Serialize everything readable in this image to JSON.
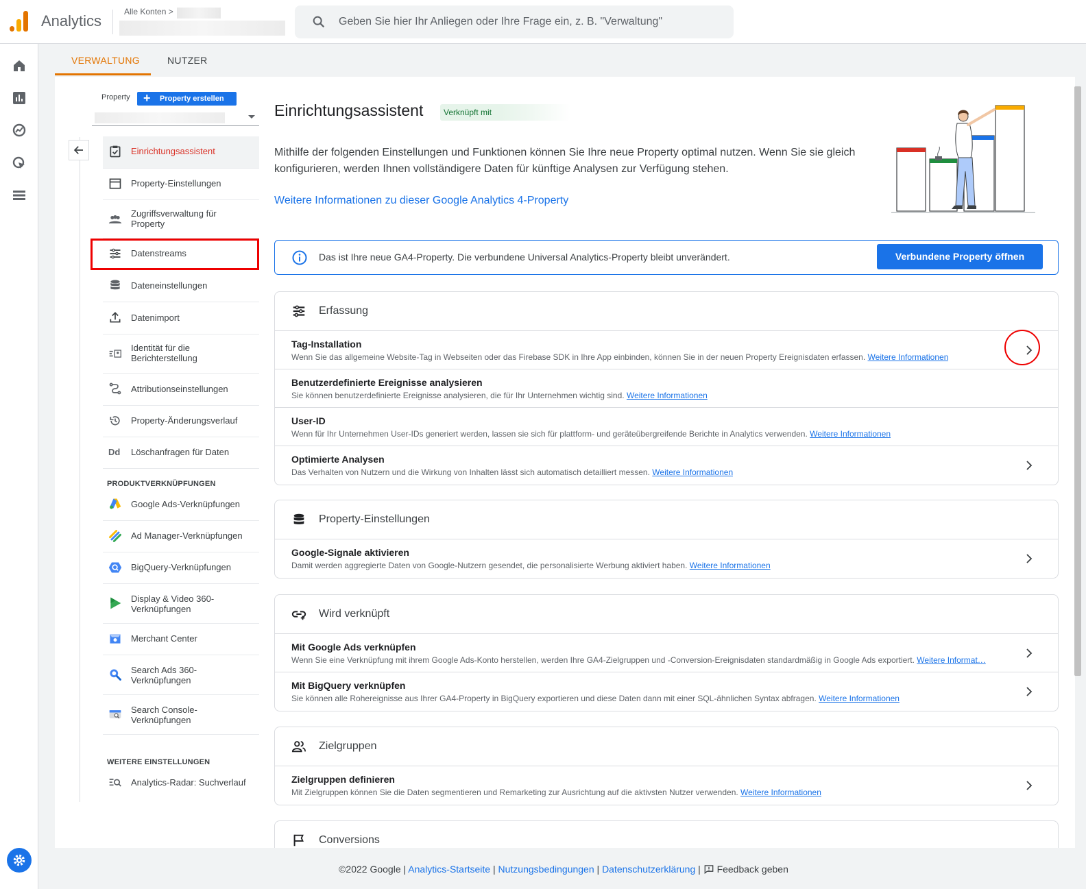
{
  "header": {
    "app_title": "Analytics",
    "account_breadcrumb": "Alle Konten >",
    "search_placeholder": "Geben Sie hier Ihr Anliegen oder Ihre Frage ein, z. B. \"Verwaltung\""
  },
  "tabs": [
    {
      "label": "VERWALTUNG",
      "active": true
    },
    {
      "label": "NUTZER",
      "active": false
    }
  ],
  "sidebar": {
    "property_label": "Property",
    "create_button": "Property erstellen",
    "items": [
      {
        "label": "Einrichtungsassistent",
        "icon": "checklist-icon",
        "active": true
      },
      {
        "label": "Property-Einstellungen",
        "icon": "window-icon"
      },
      {
        "label": "Zugriffsverwaltung für Property",
        "icon": "people-icon"
      },
      {
        "label": "Datenstreams",
        "icon": "streams-icon"
      },
      {
        "label": "Dateneinstellungen",
        "icon": "database-icon"
      },
      {
        "label": "Datenimport",
        "icon": "upload-icon"
      },
      {
        "label": "Identität für die Berichterstellung",
        "icon": "identity-icon"
      },
      {
        "label": "Attributionseinstellungen",
        "icon": "attribution-icon"
      },
      {
        "label": "Property-Änderungsverlauf",
        "icon": "history-icon"
      },
      {
        "label": "Löschanfragen für Daten",
        "icon": "dd-icon"
      }
    ],
    "section_links": "PRODUKTVERKNÜPFUNGEN",
    "links": [
      {
        "label": "Google Ads-Verknüpfungen",
        "icon": "google-ads-icon"
      },
      {
        "label": "Ad Manager-Verknüpfungen",
        "icon": "ad-manager-icon"
      },
      {
        "label": "BigQuery-Verknüpfungen",
        "icon": "bigquery-icon"
      },
      {
        "label": "Display & Video 360-Verknüpfungen",
        "icon": "dv360-icon"
      },
      {
        "label": "Merchant Center",
        "icon": "merchant-center-icon"
      },
      {
        "label": "Search Ads 360-Verknüpfungen",
        "icon": "search-ads-icon"
      },
      {
        "label": "Search Console-Verknüpfungen",
        "icon": "search-console-icon"
      }
    ],
    "section_more": "WEITERE EINSTELLUNGEN",
    "more": [
      {
        "label": "Analytics-Radar: Suchverlauf",
        "icon": "search-history-icon"
      }
    ]
  },
  "main": {
    "title": "Einrichtungsassistent",
    "chip": "Verknüpft mit",
    "intro": "Mithilfe der folgenden Einstellungen und Funktionen können Sie Ihre neue Property optimal nutzen. Wenn Sie sie gleich konfigurieren, werden Ihnen vollständigere Daten für künftige Analysen zur Verfügung stehen.",
    "more_link": "Weitere Informationen zu dieser Google Analytics 4-Property",
    "banner_text": "Das ist Ihre neue GA4-Property. Die verbundene Universal Analytics-Property bleibt unverändert.",
    "banner_button": "Verbundene Property öffnen",
    "link_label": "Weitere Informationen",
    "link_label_truncated": "Weitere Informat…",
    "cards": [
      {
        "title": "Erfassung",
        "rows": [
          {
            "title": "Tag-Installation",
            "desc": "Wenn Sie das allgemeine Website-Tag in Webseiten oder das Firebase SDK in Ihre App einbinden, können Sie in der neuen Property Ereignisdaten erfassen."
          },
          {
            "title": "Benutzerdefinierte Ereignisse analysieren",
            "desc": "Sie können benutzerdefinierte Ereignisse analysieren, die für Ihr Unternehmen wichtig sind."
          },
          {
            "title": "User-ID",
            "desc": "Wenn für Ihr Unternehmen User-IDs generiert werden, lassen sie sich für plattform- und geräteübergreifende Berichte in Analytics verwenden."
          },
          {
            "title": "Optimierte Analysen",
            "desc": "Das Verhalten von Nutzern und die Wirkung von Inhalten lässt sich automatisch detailliert messen."
          }
        ]
      },
      {
        "title": "Property-Einstellungen",
        "rows": [
          {
            "title": "Google-Signale aktivieren",
            "desc": "Damit werden aggregierte Daten von Google-Nutzern gesendet, die personalisierte Werbung aktiviert haben."
          }
        ]
      },
      {
        "title": "Wird verknüpft",
        "rows": [
          {
            "title": "Mit Google Ads verknüpfen",
            "desc": "Wenn Sie eine Verknüpfung mit ihrem Google Ads-Konto herstellen, werden Ihre GA4-Zielgruppen und -Conversion-Ereignisdaten standardmäßig in Google Ads exportiert."
          },
          {
            "title": "Mit BigQuery verknüpfen",
            "desc": "Sie können alle Rohereignisse aus Ihrer GA4-Property in BigQuery exportieren und diese Daten dann mit einer SQL-ähnlichen Syntax abfragen."
          }
        ]
      },
      {
        "title": "Zielgruppen",
        "rows": [
          {
            "title": "Zielgruppen definieren",
            "desc": "Mit Zielgruppen können Sie die Daten segmentieren und Remarketing zur Ausrichtung auf die aktivsten Nutzer verwenden."
          }
        ]
      },
      {
        "title": "Conversions",
        "rows": []
      }
    ]
  },
  "footer": {
    "copyright": "©2022 Google",
    "links": [
      "Analytics-Startseite",
      "Nutzungsbedingungen",
      "Datenschutzerklärung"
    ],
    "feedback": "Feedback geben"
  }
}
